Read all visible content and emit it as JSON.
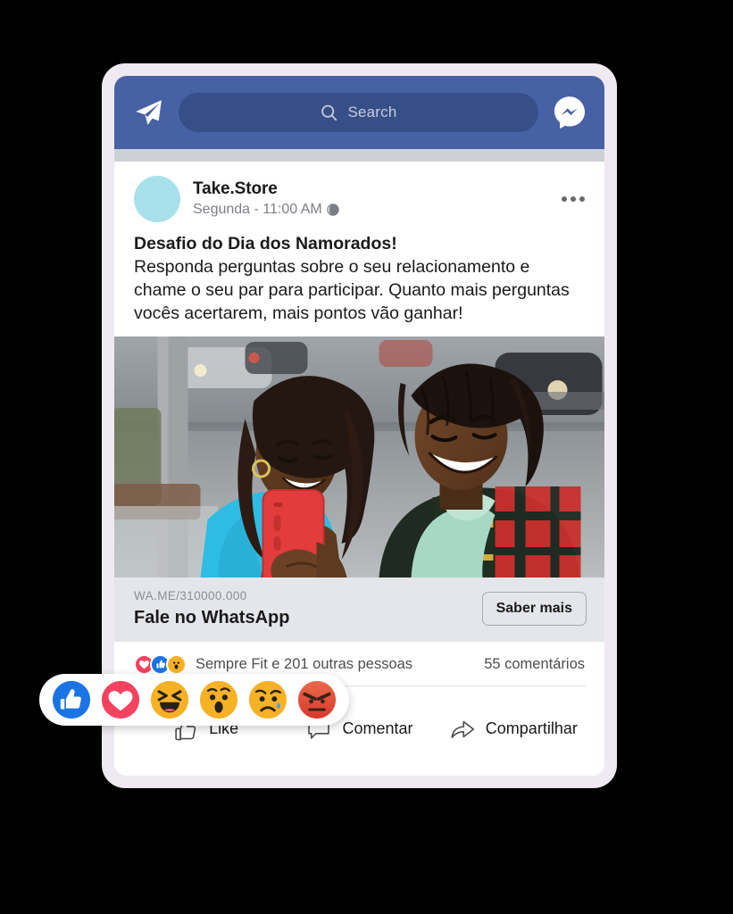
{
  "app": {
    "header": {
      "plane_icon": "paper-plane-icon",
      "search_placeholder": "Search",
      "search_icon": "search-icon",
      "messenger_icon": "messenger-icon",
      "bar_color": "#4761A5",
      "search_field_color": "#374F87"
    }
  },
  "post": {
    "avatar_color": "#A8E1EB",
    "page_name": "Take.Store",
    "timestamp": "Segunda - 11:00 AM",
    "privacy_icon": "globe-icon",
    "more_icon": "ellipsis-icon",
    "headline": "Desafio do Dia dos Namorados!",
    "text": "Responda perguntas sobre o seu relacionamento e chame o seu par para participar. Quanto mais perguntas vocês acertarem, mais pontos vão ganhar!",
    "photo_alt": "Casal sorrindo olhando um celular vermelho na rua",
    "link": {
      "url": "WA.ME/310000.000",
      "title": "Fale no WhatsApp",
      "cta_label": "Saber mais"
    },
    "stats": {
      "reaction_badges": [
        "love",
        "like",
        "wow"
      ],
      "people": "Sempre Fit e 201 outras pessoas",
      "comments": "55 comentários"
    },
    "actions": [
      {
        "label": "Like",
        "icon": "thumbs-up-icon"
      },
      {
        "label": "Comentar",
        "icon": "comment-bubble-icon"
      },
      {
        "label": "Compartilhar",
        "icon": "share-arrow-icon"
      }
    ]
  },
  "reaction_popup": {
    "items": [
      {
        "name": "like",
        "label": "Like",
        "color": "#1B74E4"
      },
      {
        "name": "love",
        "label": "Love",
        "color": "#F3425F"
      },
      {
        "name": "haha",
        "label": "Haha",
        "color": "#F7B125"
      },
      {
        "name": "wow",
        "label": "Wow",
        "color": "#F7B125"
      },
      {
        "name": "sad",
        "label": "Sad",
        "color": "#F7B125"
      },
      {
        "name": "angry",
        "label": "Angry",
        "color": "#E9710F"
      }
    ]
  },
  "colors": {
    "page_background": "#000000",
    "device_frame": "#EFEAF1",
    "link_card_background": "#E4E6EB"
  }
}
